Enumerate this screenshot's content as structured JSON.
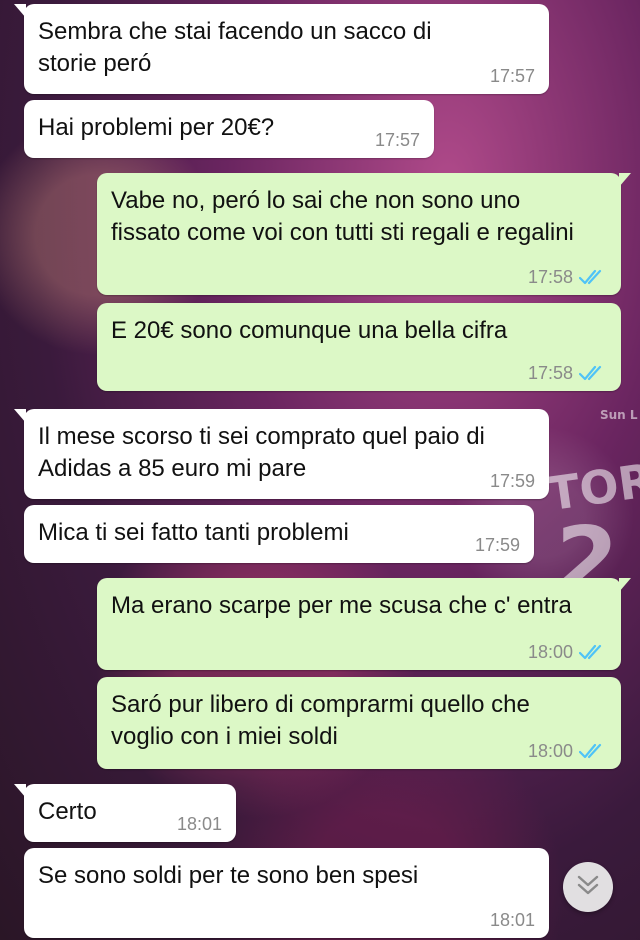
{
  "wallpaper": {
    "marks": [
      "TOR",
      "2",
      "Sun L"
    ]
  },
  "messages": [
    {
      "direction": "incoming",
      "text": "Sembra che stai facendo un sacco di storie peró",
      "time": "17:57"
    },
    {
      "direction": "incoming",
      "text": "Hai problemi per 20€?",
      "time": "17:57"
    },
    {
      "direction": "outgoing",
      "text": "Vabe no, peró lo sai che non sono uno fissato come voi con tutti sti regali e regalini",
      "time": "17:58",
      "status": "read"
    },
    {
      "direction": "outgoing",
      "text": "E 20€ sono comunque una bella cifra",
      "time": "17:58",
      "status": "read"
    },
    {
      "direction": "incoming",
      "text": "Il mese scorso ti sei comprato quel paio di Adidas a 85 euro mi pare",
      "time": "17:59"
    },
    {
      "direction": "incoming",
      "text": "Mica ti sei fatto tanti problemi",
      "time": "17:59"
    },
    {
      "direction": "outgoing",
      "text": "Ma erano scarpe per me scusa che c' entra",
      "time": "18:00",
      "status": "read"
    },
    {
      "direction": "outgoing",
      "text": "Saró pur libero di comprarmi quello che voglio con i miei soldi",
      "time": "18:00",
      "status": "read"
    },
    {
      "direction": "incoming",
      "text": "Certo",
      "time": "18:01"
    },
    {
      "direction": "incoming",
      "text": "Se sono soldi per te sono ben spesi",
      "time": "18:01"
    }
  ],
  "colors": {
    "incoming_bubble": "#ffffff",
    "outgoing_bubble": "#dcf8c6",
    "read_ticks": "#4fc3f7",
    "timestamp": "#8a8a8a"
  },
  "scroll_button": {
    "icon": "double-chevron-down-icon"
  }
}
